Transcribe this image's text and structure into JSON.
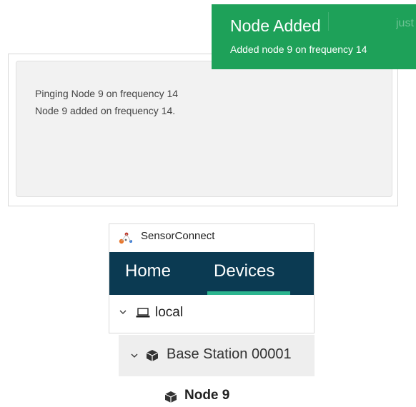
{
  "log": {
    "lines": [
      "Pinging Node 9 on frequency 14",
      "Node 9 added on frequency 14."
    ]
  },
  "toast": {
    "title": "Node Added",
    "message": "Added node 9 on frequency 14",
    "time": "just",
    "color": "#1ea159"
  },
  "app": {
    "name": "SensorConnect",
    "nav": {
      "tabs": [
        "Home",
        "Devices"
      ],
      "active": "Devices",
      "color": "#0b3a52",
      "accent": "#2bb58f"
    },
    "tree": {
      "local_label": "local",
      "base_station_label": "Base Station 00001",
      "node_label": "Node 9"
    }
  }
}
